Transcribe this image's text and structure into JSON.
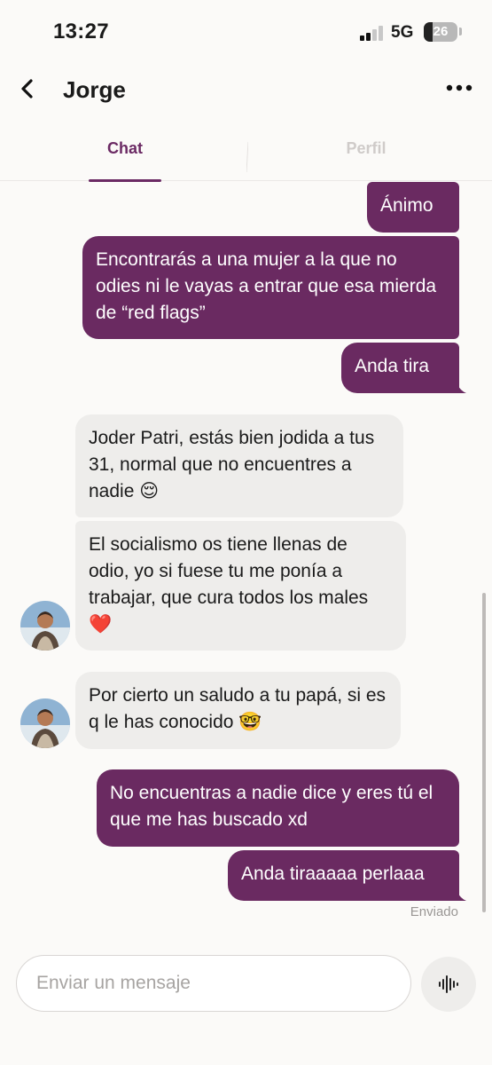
{
  "status_bar": {
    "time": "13:27",
    "network": "5G",
    "battery": "26",
    "battery_level": 0.26
  },
  "header": {
    "contact_name": "Jorge",
    "back_icon": "chevron-left-icon",
    "more_icon": "more-horizontal-icon"
  },
  "tabs": [
    {
      "label": "Chat",
      "active": true
    },
    {
      "label": "Perfil",
      "active": false
    }
  ],
  "messages": [
    {
      "direction": "out",
      "text": "Ánimo"
    },
    {
      "direction": "out",
      "text": "Encontrarás a una mujer a la que no odies ni le vayas a entrar que esa mierda de “red flags”"
    },
    {
      "direction": "out",
      "text": "Anda tira"
    },
    {
      "direction": "in",
      "text": "Joder Patri, estás bien jodida a tus 31, normal que no encuentres a nadie 😌"
    },
    {
      "direction": "in",
      "text": "El socialismo os tiene llenas de odio, yo si fuese tu me ponía a trabajar, que cura todos los males ❤️"
    },
    {
      "direction": "in",
      "text": "Por cierto un saludo a tu papá, si es q le has conocido 🤓"
    },
    {
      "direction": "out",
      "text": "No encuentras a nadie dice y eres tú el que me has buscado xd"
    },
    {
      "direction": "out",
      "text": "Anda tiraaaaa perlaaa"
    }
  ],
  "delivery_status": "Enviado",
  "composer": {
    "placeholder": "Enviar un mensaje",
    "mic_icon": "voice-waveform-icon"
  },
  "colors": {
    "accent": "#6b2a64",
    "outgoing_bubble": "#6a2a61",
    "incoming_bubble": "#eeedeb",
    "inactive_tab": "#cfcbc9"
  }
}
